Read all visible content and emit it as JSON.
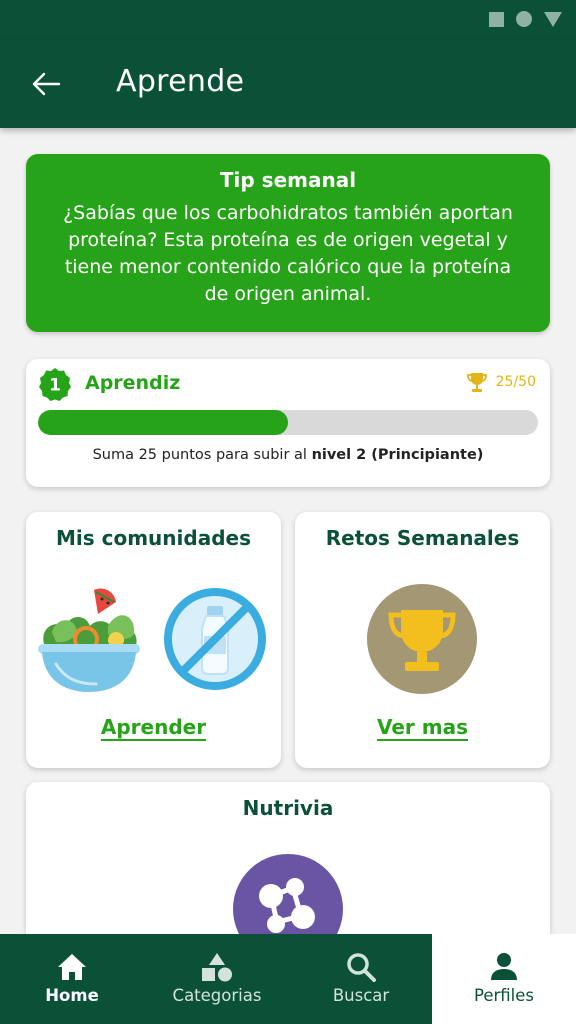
{
  "header": {
    "title": "Aprende"
  },
  "tip": {
    "title": "Tip semanal",
    "body": "¿Sabías que los carbohidratos también aportan proteína? Esta proteína es de origen vegetal y tiene menor contenido calórico que la proteína de origen animal."
  },
  "level": {
    "number": "1",
    "name": "Aprendiz",
    "points_label": "25/50",
    "progress": 0.5,
    "hint_prefix": "Suma 25 puntos para subir al ",
    "hint_bold": "nivel 2 (Principiante)"
  },
  "cards": {
    "communities": {
      "title": "Mis comunidades",
      "link": "Aprender",
      "icons": [
        "salad-bowl-icon",
        "no-bottle-icon"
      ]
    },
    "challenges": {
      "title": "Retos Semanales",
      "link": "Ver mas",
      "icon": "trophy-icon"
    },
    "nutrivia": {
      "title": "Nutrivia",
      "icon": "molecule-icon"
    }
  },
  "nav": {
    "items": [
      {
        "label": "Home",
        "icon": "home-icon"
      },
      {
        "label": "Categorias",
        "icon": "shapes-icon"
      },
      {
        "label": "Buscar",
        "icon": "search-icon"
      },
      {
        "label": "Perfiles",
        "icon": "person-icon"
      }
    ]
  },
  "colors": {
    "primary_dark": "#0b5137",
    "accent_green": "#27a319",
    "gold": "#e3b417",
    "trophy_circle": "#a39774",
    "molecule_circle": "#6a55a5"
  }
}
